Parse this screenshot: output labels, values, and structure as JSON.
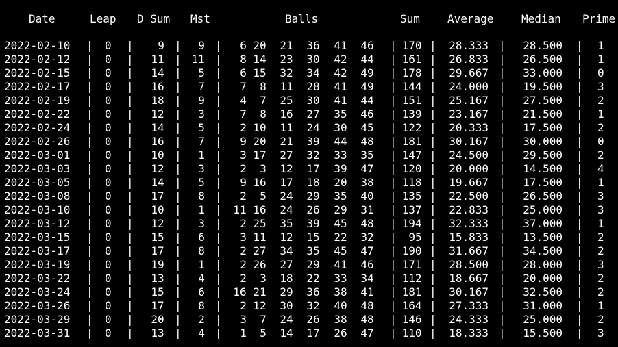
{
  "colors": {
    "background": "#000000",
    "foreground": "#ffffff"
  },
  "header": {
    "date": "Date",
    "leap": "Leap",
    "d_sum": "D_Sum",
    "mst": "Mst",
    "balls": "Balls",
    "sum": "Sum",
    "average": "Average",
    "median": "Median",
    "prime": "Prime"
  },
  "separator": "|",
  "rows": [
    {
      "date": "2022-02-10",
      "leap": "0",
      "d_sum": "9",
      "mst": "9",
      "balls": [
        "6",
        "20",
        "21",
        "36",
        "41",
        "46"
      ],
      "sum": "170",
      "average": "28.333",
      "median": "28.500",
      "prime": "1"
    },
    {
      "date": "2022-02-12",
      "leap": "0",
      "d_sum": "11",
      "mst": "11",
      "balls": [
        "8",
        "14",
        "23",
        "30",
        "42",
        "44"
      ],
      "sum": "161",
      "average": "26.833",
      "median": "26.500",
      "prime": "1"
    },
    {
      "date": "2022-02-15",
      "leap": "0",
      "d_sum": "14",
      "mst": "5",
      "balls": [
        "6",
        "15",
        "32",
        "34",
        "42",
        "49"
      ],
      "sum": "178",
      "average": "29.667",
      "median": "33.000",
      "prime": "0"
    },
    {
      "date": "2022-02-17",
      "leap": "0",
      "d_sum": "16",
      "mst": "7",
      "balls": [
        "7",
        "8",
        "11",
        "28",
        "41",
        "49"
      ],
      "sum": "144",
      "average": "24.000",
      "median": "19.500",
      "prime": "3"
    },
    {
      "date": "2022-02-19",
      "leap": "0",
      "d_sum": "18",
      "mst": "9",
      "balls": [
        "4",
        "7",
        "25",
        "30",
        "41",
        "44"
      ],
      "sum": "151",
      "average": "25.167",
      "median": "27.500",
      "prime": "2"
    },
    {
      "date": "2022-02-22",
      "leap": "0",
      "d_sum": "12",
      "mst": "3",
      "balls": [
        "7",
        "8",
        "16",
        "27",
        "35",
        "46"
      ],
      "sum": "139",
      "average": "23.167",
      "median": "21.500",
      "prime": "1"
    },
    {
      "date": "2022-02-24",
      "leap": "0",
      "d_sum": "14",
      "mst": "5",
      "balls": [
        "2",
        "10",
        "11",
        "24",
        "30",
        "45"
      ],
      "sum": "122",
      "average": "20.333",
      "median": "17.500",
      "prime": "2"
    },
    {
      "date": "2022-02-26",
      "leap": "0",
      "d_sum": "16",
      "mst": "7",
      "balls": [
        "9",
        "20",
        "21",
        "39",
        "44",
        "48"
      ],
      "sum": "181",
      "average": "30.167",
      "median": "30.000",
      "prime": "0"
    },
    {
      "date": "2022-03-01",
      "leap": "0",
      "d_sum": "10",
      "mst": "1",
      "balls": [
        "3",
        "17",
        "27",
        "32",
        "33",
        "35"
      ],
      "sum": "147",
      "average": "24.500",
      "median": "29.500",
      "prime": "2"
    },
    {
      "date": "2022-03-03",
      "leap": "0",
      "d_sum": "12",
      "mst": "3",
      "balls": [
        "2",
        "3",
        "12",
        "17",
        "39",
        "47"
      ],
      "sum": "120",
      "average": "20.000",
      "median": "14.500",
      "prime": "4"
    },
    {
      "date": "2022-03-05",
      "leap": "0",
      "d_sum": "14",
      "mst": "5",
      "balls": [
        "9",
        "16",
        "17",
        "18",
        "20",
        "38"
      ],
      "sum": "118",
      "average": "19.667",
      "median": "17.500",
      "prime": "1"
    },
    {
      "date": "2022-03-08",
      "leap": "0",
      "d_sum": "17",
      "mst": "8",
      "balls": [
        "2",
        "5",
        "24",
        "29",
        "35",
        "40"
      ],
      "sum": "135",
      "average": "22.500",
      "median": "26.500",
      "prime": "3"
    },
    {
      "date": "2022-03-10",
      "leap": "0",
      "d_sum": "10",
      "mst": "1",
      "balls": [
        "11",
        "16",
        "24",
        "26",
        "29",
        "31"
      ],
      "sum": "137",
      "average": "22.833",
      "median": "25.000",
      "prime": "3"
    },
    {
      "date": "2022-03-12",
      "leap": "0",
      "d_sum": "12",
      "mst": "3",
      "balls": [
        "2",
        "25",
        "35",
        "39",
        "45",
        "48"
      ],
      "sum": "194",
      "average": "32.333",
      "median": "37.000",
      "prime": "1"
    },
    {
      "date": "2022-03-15",
      "leap": "0",
      "d_sum": "15",
      "mst": "6",
      "balls": [
        "3",
        "11",
        "12",
        "15",
        "22",
        "32"
      ],
      "sum": "95",
      "average": "15.833",
      "median": "13.500",
      "prime": "2"
    },
    {
      "date": "2022-03-17",
      "leap": "0",
      "d_sum": "17",
      "mst": "8",
      "balls": [
        "2",
        "27",
        "34",
        "35",
        "45",
        "47"
      ],
      "sum": "190",
      "average": "31.667",
      "median": "34.500",
      "prime": "2"
    },
    {
      "date": "2022-03-19",
      "leap": "0",
      "d_sum": "19",
      "mst": "1",
      "balls": [
        "2",
        "26",
        "27",
        "29",
        "41",
        "46"
      ],
      "sum": "171",
      "average": "28.500",
      "median": "28.000",
      "prime": "3"
    },
    {
      "date": "2022-03-22",
      "leap": "0",
      "d_sum": "13",
      "mst": "4",
      "balls": [
        "2",
        "3",
        "18",
        "22",
        "33",
        "34"
      ],
      "sum": "112",
      "average": "18.667",
      "median": "20.000",
      "prime": "2"
    },
    {
      "date": "2022-03-24",
      "leap": "0",
      "d_sum": "15",
      "mst": "6",
      "balls": [
        "16",
        "21",
        "29",
        "36",
        "38",
        "41"
      ],
      "sum": "181",
      "average": "30.167",
      "median": "32.500",
      "prime": "2"
    },
    {
      "date": "2022-03-26",
      "leap": "0",
      "d_sum": "17",
      "mst": "8",
      "balls": [
        "2",
        "12",
        "30",
        "32",
        "40",
        "48"
      ],
      "sum": "164",
      "average": "27.333",
      "median": "31.000",
      "prime": "1"
    },
    {
      "date": "2022-03-29",
      "leap": "0",
      "d_sum": "20",
      "mst": "2",
      "balls": [
        "3",
        "7",
        "24",
        "26",
        "38",
        "48"
      ],
      "sum": "146",
      "average": "24.333",
      "median": "25.000",
      "prime": "2"
    },
    {
      "date": "2022-03-31",
      "leap": "0",
      "d_sum": "13",
      "mst": "4",
      "balls": [
        "1",
        "5",
        "14",
        "17",
        "26",
        "47"
      ],
      "sum": "110",
      "average": "18.333",
      "median": "15.500",
      "prime": "3"
    }
  ]
}
